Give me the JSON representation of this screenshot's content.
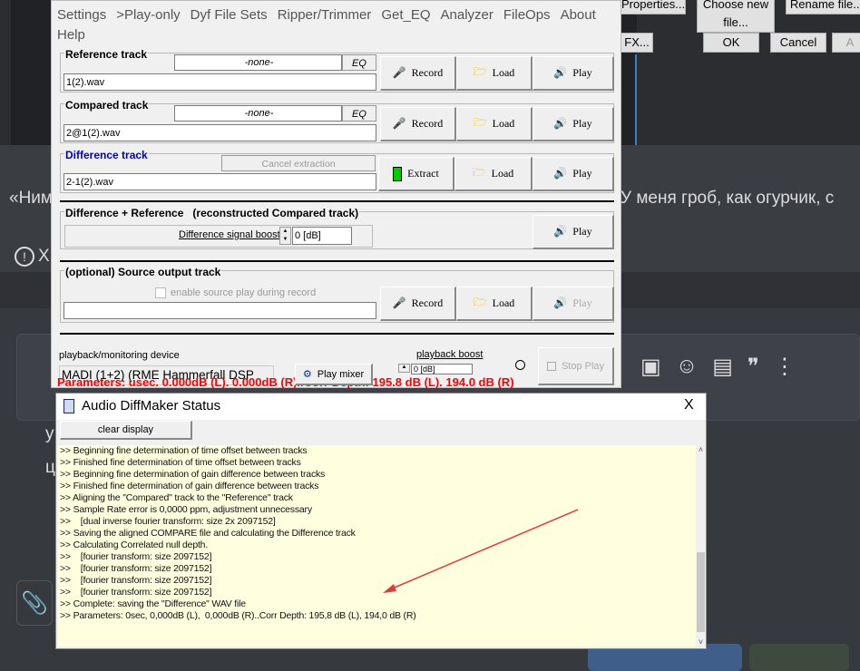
{
  "background": {
    "top_buttons": [
      "Properties...",
      "Choose new file...",
      "Rename file..."
    ],
    "fx": "FX...",
    "ok": "OK",
    "cancel": "Cancel",
    "apply": "A",
    "text_left": "«Ним",
    "text_right": "У меня гроб, как огурчик, с",
    "alert_text": "Х",
    "side_letters": [
      "у",
      "ц"
    ]
  },
  "menu": [
    "Settings",
    ">Play-only",
    "Dyf File Sets",
    "Ripper/Trimmer",
    "Get_EQ",
    "Analyzer",
    "FileOps",
    "About",
    "Help"
  ],
  "reference": {
    "label": "Reference track",
    "eq_value": "-none-",
    "eq": "EQ",
    "file": "1(2).wav",
    "record": "Record",
    "load": "Load",
    "play": "Play"
  },
  "compared": {
    "label": "Compared track",
    "eq_value": "-none-",
    "eq": "EQ",
    "file": "2@1(2).wav",
    "record": "Record",
    "load": "Load",
    "play": "Play"
  },
  "difference": {
    "label": "Difference track",
    "cancel": "Cancel extraction",
    "file": "2-1(2).wav",
    "extract": "Extract",
    "load": "Load",
    "play": "Play"
  },
  "diffref": {
    "label": "Difference + Reference   (reconstructed Compared track)",
    "boost_label": "Difference signal boost:",
    "boost_value": "0 [dB]",
    "play": "Play"
  },
  "source": {
    "label": "(optional) Source output track",
    "checkbox": "enable source play during record",
    "file": "",
    "record": "Record",
    "load": "Load",
    "play": "Play"
  },
  "playback": {
    "device_label": "playback/monitoring device",
    "device": "MADI (1+2) (RME Hammerfall DSP",
    "mixer": "Play mixer",
    "boost_label": "playback boost",
    "boost_value": "0 [dB]",
    "stop": "Stop Play"
  },
  "params_red": "Parameters: usec. 0.000dB (L).  0.000dB (R)..Corr Depth: 195.8 dB (L). 194.0 dB (R)",
  "status": {
    "title": "Audio DiffMaker Status",
    "close": "X",
    "clear": "clear display",
    "lines": [
      ">> Beginning fine determination of time offset between tracks",
      ">> Finished fine determination of time offset between tracks",
      ">> Beginning fine determination of gain difference between tracks",
      ">> Finished fine determination of gain difference between tracks",
      ">> Aligning the \"Compared\" track to the \"Reference\" track",
      ">> Sample Rate error is 0,0000 ppm, adjustment unnecessary",
      ">>    [dual inverse fourier transform: size 2x 2097152]",
      ">> Saving the aligned COMPARE file and calculating the Difference track",
      ">> Calculating Correlated null depth.",
      ">>    [fourier transform: size 2097152]",
      ">>    [fourier transform: size 2097152]",
      ">>    [fourier transform: size 2097152]",
      ">>    [fourier transform: size 2097152]",
      ">> Complete: saving the \"Difference\" WAV file",
      ">> Parameters: 0sec, 0,000dB (L),  0,000dB (R)..Corr Depth: 195,8 dB (L), 194,0 dB (R)"
    ]
  },
  "colors": {
    "annotation_arrow": "#e53935",
    "params": "#ff0000",
    "log_bg": "#ffffe0",
    "diff_label": "#0000c0"
  }
}
